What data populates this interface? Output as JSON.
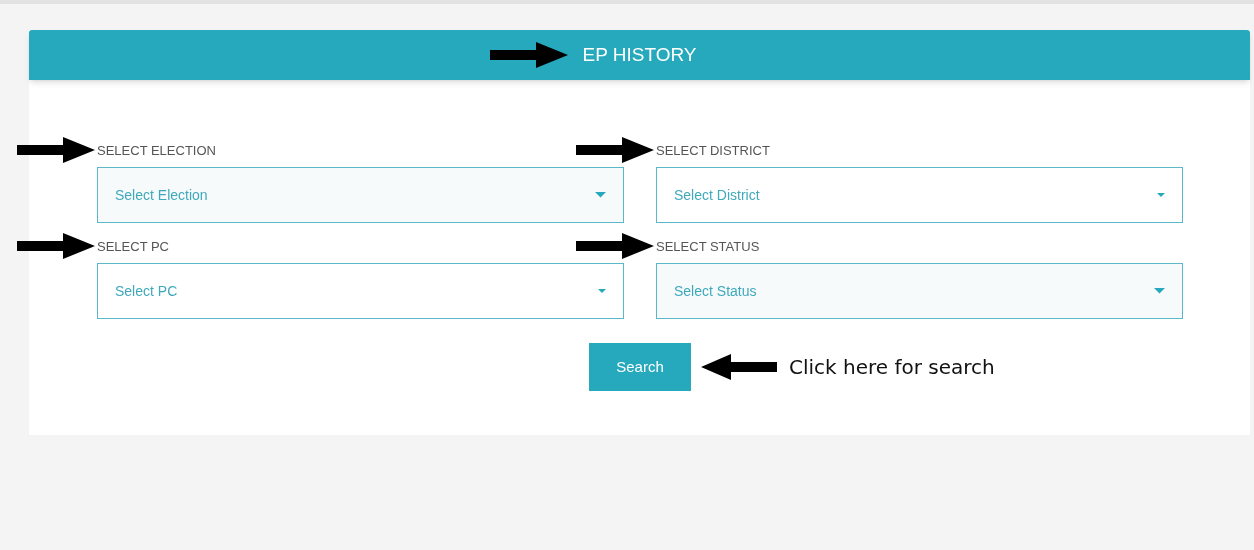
{
  "panel": {
    "title": "EP HISTORY"
  },
  "fields": [
    {
      "label": "SELECT ELECTION",
      "placeholder": "Select Election",
      "highlighted": true
    },
    {
      "label": "SELECT DISTRICT",
      "placeholder": "Select District",
      "highlighted": false
    },
    {
      "label": "SELECT PC",
      "placeholder": "Select PC",
      "highlighted": false
    },
    {
      "label": "SELECT STATUS",
      "placeholder": "Select Status",
      "highlighted": true
    }
  ],
  "search": {
    "button": "Search",
    "note": "Click here for search"
  }
}
